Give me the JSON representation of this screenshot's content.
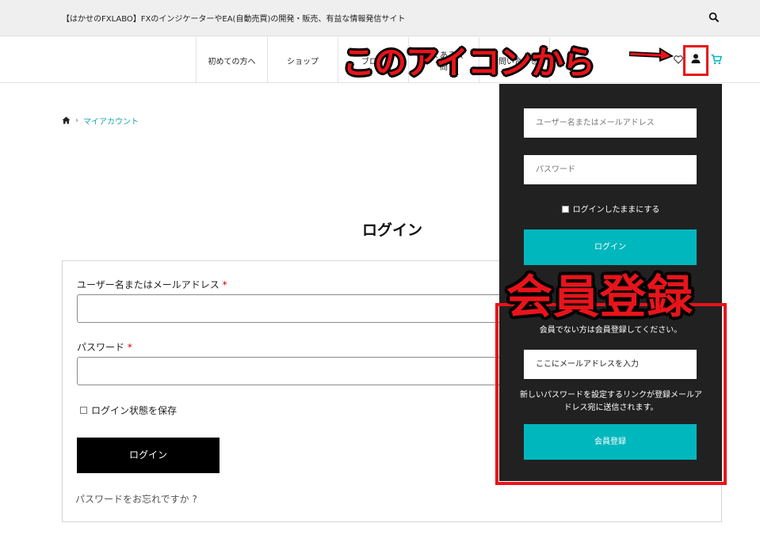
{
  "header": {
    "site_title": "【はかせのFXLABO】FXのインジケーターやEA(自動売買)の開発・販売、有益な情報発信サイト",
    "search_icon": "search-icon"
  },
  "nav": {
    "items": [
      {
        "label": "初めての方へ",
        "label2": ""
      },
      {
        "label": "ショップ",
        "label2": ""
      },
      {
        "label": "ブログ",
        "label2": ""
      },
      {
        "label": "よくある質",
        "label2": "問"
      },
      {
        "label": "お問い合わせ",
        "label2": ""
      }
    ],
    "icons": [
      "heart-icon",
      "account-icon",
      "cart-icon"
    ]
  },
  "annotation": {
    "icon_callout": "このアイコンから",
    "register_callout": "会員登録",
    "color": "#e8141b"
  },
  "breadcrumb": {
    "home_icon": "home-icon",
    "current": "マイアカウント"
  },
  "login": {
    "heading": "ログイン",
    "username_label": "ユーザー名またはメールアドレス",
    "password_label": "パスワード",
    "required_mark": "*",
    "remember_label": "ログイン状態を保存",
    "submit_label": "ログイン",
    "forgot_link": "パスワードをお忘れですか ?"
  },
  "dropdown": {
    "username_placeholder": "ユーザー名またはメールアドレス",
    "password_placeholder": "パスワード",
    "remember_label": "ログインしたままにする",
    "login_button": "ログイン",
    "register_note": "会員でない方は会員登録してください。",
    "email_placeholder": "ここにメールアドレスを入力",
    "info_text": "新しいパスワードを設定するリンクが登録メールアドレス宛に送信されます。",
    "register_button": "会員登録",
    "accent": "#00b7bd",
    "background": "#212121"
  }
}
